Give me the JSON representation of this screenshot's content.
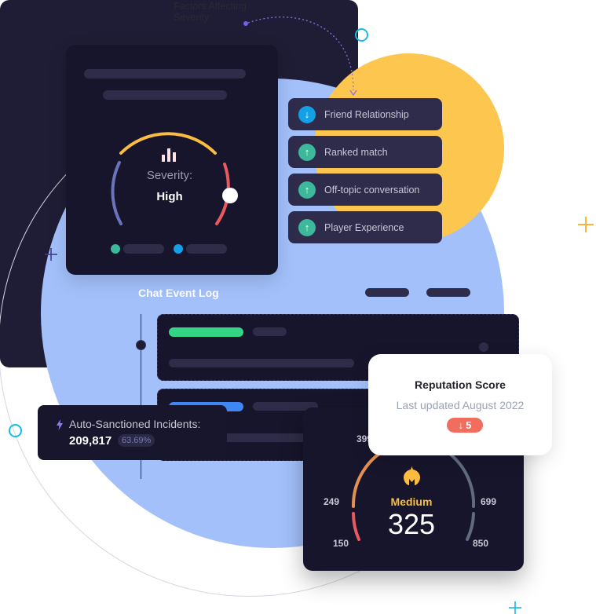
{
  "annotation": {
    "text_line1": "Factors Affecting",
    "text_line2": "Severity"
  },
  "severity_card": {
    "label": "Severity:",
    "value": "High",
    "icon": "bar-chart-icon",
    "gauge_colors": {
      "low": "#6b73bb",
      "medium": "#fbbd41",
      "high": "#e85a5f"
    },
    "legend_dot_colors": [
      "#3cb89b",
      "#12a0e6"
    ]
  },
  "factors": [
    {
      "label": "Friend Relationship",
      "direction": "down",
      "icon": "arrow-down-icon",
      "color": "#12a0e6"
    },
    {
      "label": "Ranked match",
      "direction": "up",
      "icon": "arrow-up-icon",
      "color": "#3cb89b"
    },
    {
      "label": "Off-topic conversation",
      "direction": "up",
      "icon": "arrow-up-icon",
      "color": "#3cb89b"
    },
    {
      "label": "Player Experience",
      "direction": "up",
      "icon": "arrow-up-icon",
      "color": "#3cb89b"
    }
  ],
  "chat_log": {
    "title": "Chat Event Log",
    "event_tag_colors": [
      "#34d585",
      "#3f87f5"
    ]
  },
  "incidents": {
    "label": "Auto-Sanctioned Incidents:",
    "count": "209,817",
    "percent": "63.69%",
    "icon": "lightning-icon"
  },
  "reputation": {
    "title": "Reputation Score",
    "updated": "Last updated August 2022",
    "change": "5",
    "change_arrow": "↓",
    "change_color": "#f16d5e"
  },
  "score_gauge": {
    "level": "Medium",
    "score": "325",
    "icon": "spartan-helmet-icon",
    "ticks": {
      "t150": "150",
      "t249": "249",
      "t399": "399",
      "t699": "699",
      "t850": "850"
    },
    "colors": {
      "low": "#e85a5f",
      "medium": "#e39050",
      "high": "#626a80",
      "accent": "#fbbd41"
    }
  }
}
